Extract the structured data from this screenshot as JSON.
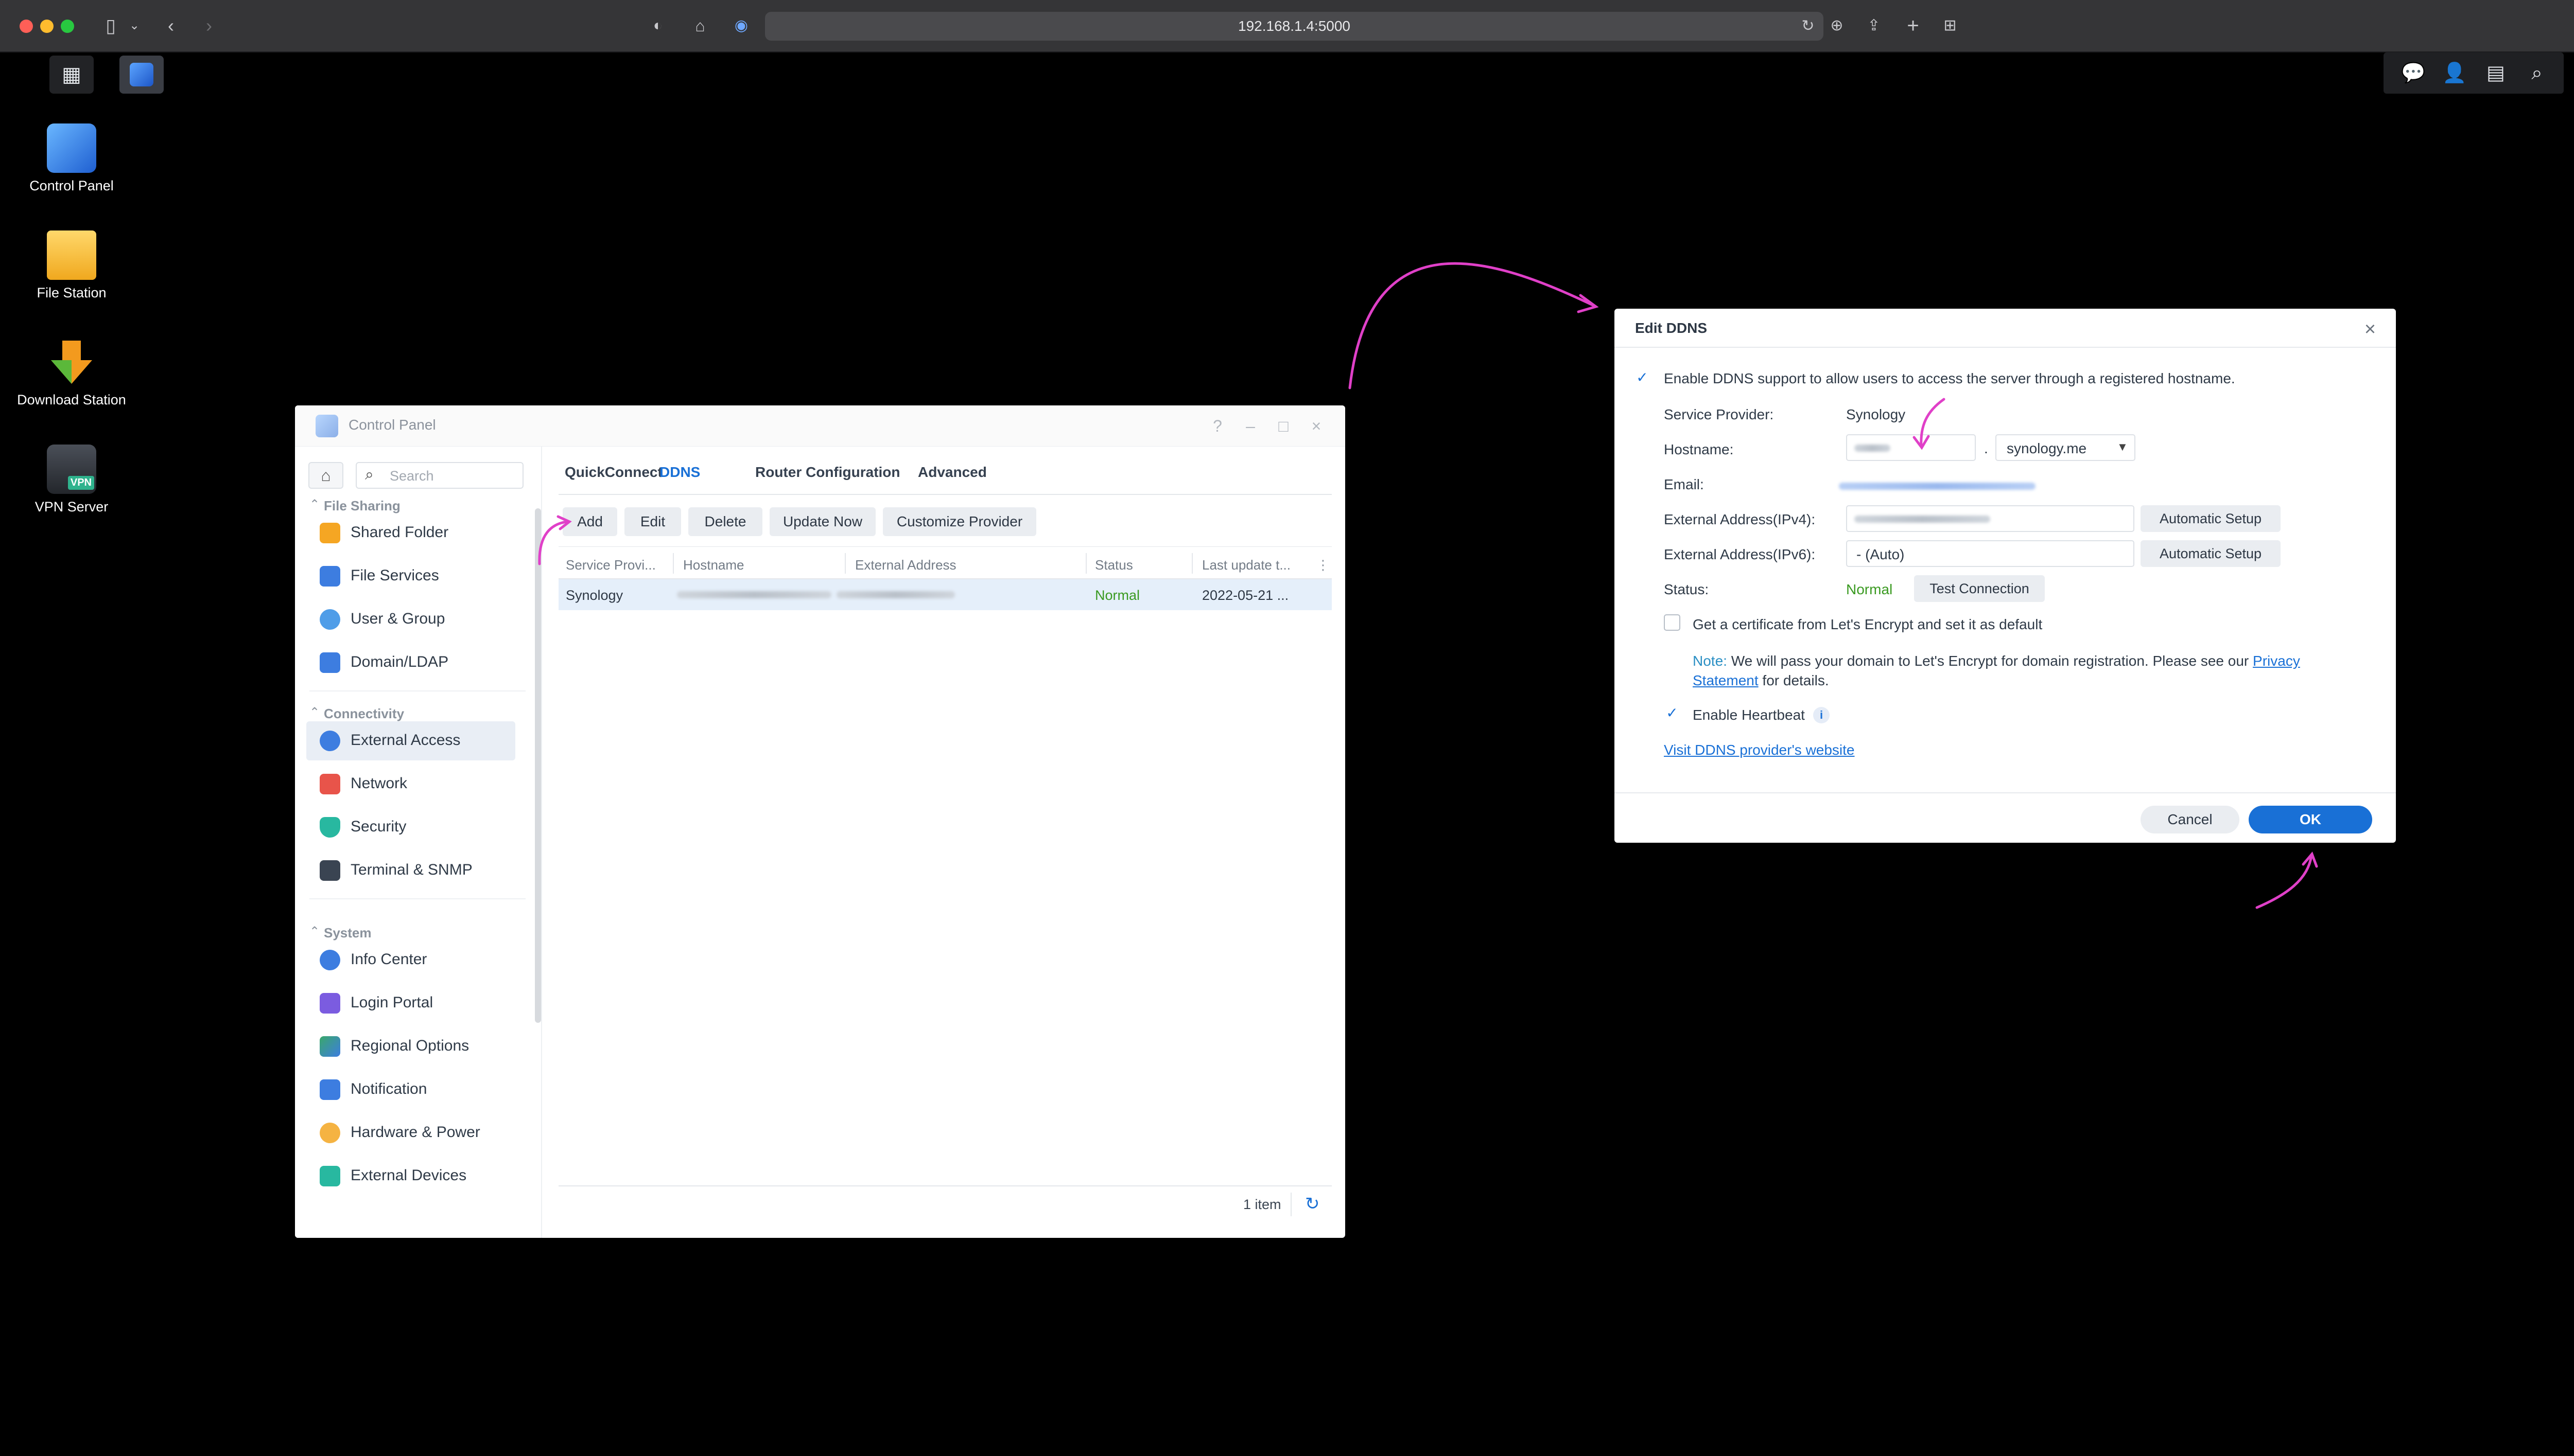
{
  "browser": {
    "url": "192.168.1.4:5000"
  },
  "desktop": {
    "icons": [
      {
        "label": "Control Panel"
      },
      {
        "label": "File Station"
      },
      {
        "label": "Download Station"
      },
      {
        "label": "VPN Server"
      }
    ],
    "vpn_badge": "VPN"
  },
  "control_panel": {
    "title": "Control Panel",
    "search_placeholder": "Search",
    "sections": [
      {
        "title": "File Sharing",
        "items": [
          "Shared Folder",
          "File Services",
          "User & Group",
          "Domain/LDAP"
        ]
      },
      {
        "title": "Connectivity",
        "items": [
          "External Access",
          "Network",
          "Security",
          "Terminal & SNMP"
        ]
      },
      {
        "title": "System",
        "items": [
          "Info Center",
          "Login Portal",
          "Regional Options",
          "Notification",
          "Hardware & Power",
          "External Devices"
        ]
      }
    ],
    "active_item": "External Access",
    "tabs": [
      "QuickConnect",
      "DDNS",
      "Router Configuration",
      "Advanced"
    ],
    "active_tab": "DDNS",
    "toolbar": [
      "Add",
      "Edit",
      "Delete",
      "Update Now",
      "Customize Provider"
    ],
    "columns": [
      "Service Provi...",
      "Hostname",
      "External Address",
      "Status",
      "Last update t..."
    ],
    "rows": [
      {
        "provider": "Synology",
        "status": "Normal",
        "last_update": "2022-05-21 ..."
      }
    ],
    "item_count": "1 item"
  },
  "dialog": {
    "title": "Edit DDNS",
    "enable_label": "Enable DDNS support to allow users to access the server through a registered hostname.",
    "service_provider_label": "Service Provider:",
    "service_provider_value": "Synology",
    "hostname_label": "Hostname:",
    "hostname_dot": ".",
    "domain_value": "synology.me",
    "email_label": "Email:",
    "ipv4_label": "External Address(IPv4):",
    "ipv6_label": "External Address(IPv6):",
    "ipv6_value": "- (Auto)",
    "auto_setup": "Automatic Setup",
    "status_label": "Status:",
    "status_value": "Normal",
    "test_connection": "Test Connection",
    "cert_label": "Get a certificate from Let's Encrypt and set it as default",
    "note_label": "Note:",
    "note_text": " We will pass your domain to Let's Encrypt for domain registration. Please see our ",
    "privacy_1": "Privacy",
    "privacy_2": "Statement",
    "note_tail": " for details.",
    "heartbeat_label": "Enable Heartbeat",
    "info_glyph": "i",
    "visit_link": "Visit DDNS provider's website",
    "cancel": "Cancel",
    "ok": "OK"
  },
  "colors": {
    "accent": "#1970d6",
    "status_green": "#3a9a21",
    "annotation": "#e040c8"
  }
}
